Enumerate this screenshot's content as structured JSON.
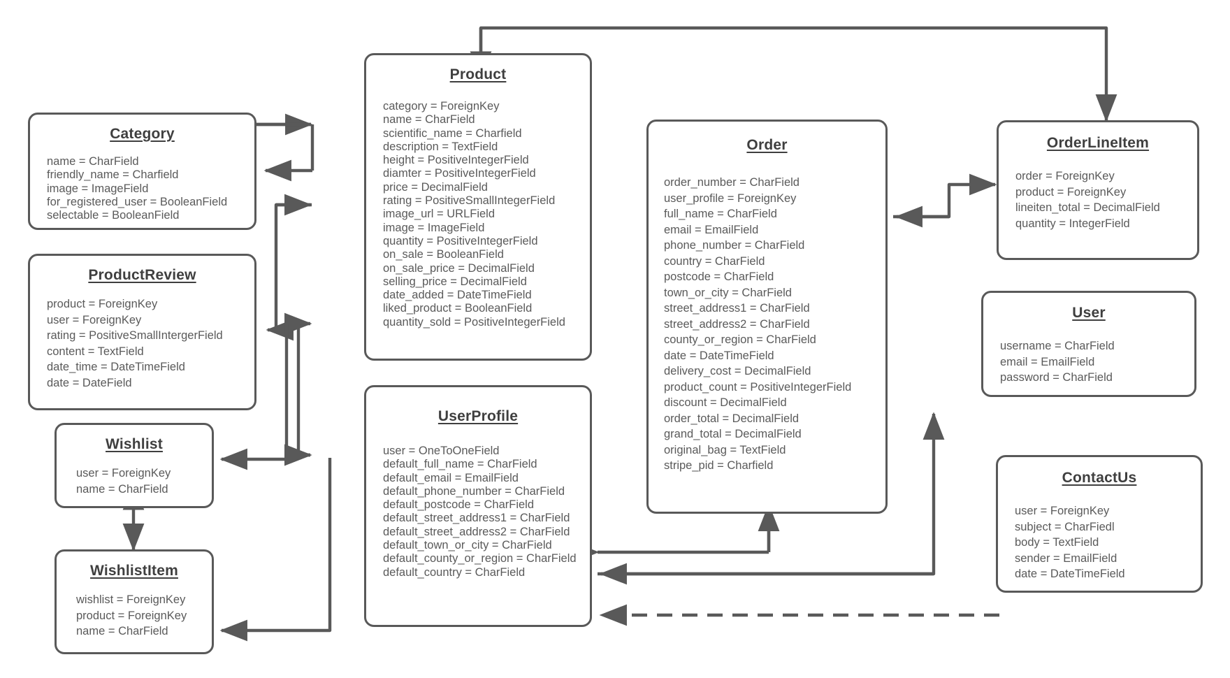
{
  "diagram": {
    "kind": "django-model-er-diagram",
    "background_color": "#ffffff",
    "box_border_color": "#595959",
    "text_color": "#5a5a5a",
    "title_color": "#3f3f3f",
    "connector_color": "#595959"
  },
  "entities": {
    "category": {
      "title": "Category",
      "fields": [
        "name = CharField",
        "friendly_name = Charfield",
        "image = ImageField",
        "for_registered_user = BooleanField",
        "selectable = BooleanField"
      ]
    },
    "product_review": {
      "title": "ProductReview",
      "fields": [
        "product = ForeignKey",
        "user = ForeignKey",
        "rating = PositiveSmallIntergerField",
        "content = TextField",
        "date_time = DateTimeField",
        "date = DateField"
      ]
    },
    "wishlist": {
      "title": "Wishlist",
      "fields": [
        "user = ForeignKey",
        "name = CharField"
      ]
    },
    "wishlist_item": {
      "title": "WishlistItem",
      "fields": [
        "wishlist = ForeignKey",
        "product = ForeignKey",
        "name = CharField"
      ]
    },
    "product": {
      "title": "Product",
      "fields": [
        "category = ForeignKey",
        "name = CharField",
        "scientific_name = Charfield",
        "description = TextField",
        "height = PositiveIntegerField",
        "diamter = PositiveIntegerField",
        "price = DecimalField",
        "rating = PositiveSmallIntegerField",
        "image_url = URLField",
        "image = ImageField",
        "quantity = PositiveIntegerField",
        "on_sale = BooleanField",
        "on_sale_price = DecimalField",
        "selling_price = DecimalField",
        "date_added = DateTimeField",
        "liked_product = BooleanField",
        "quantity_sold = PositiveIntegerField"
      ]
    },
    "user_profile": {
      "title": "UserProfile",
      "fields": [
        "user = OneToOneField",
        "default_full_name = CharField",
        "default_email = EmailField",
        "default_phone_number = CharField",
        "default_postcode = CharField",
        "default_street_address1 = CharField",
        "default_street_address2 = CharField",
        "default_town_or_city = CharField",
        "default_county_or_region = CharField",
        "default_country = CharField"
      ]
    },
    "order": {
      "title": "Order",
      "fields": [
        "order_number = CharField",
        "user_profile = ForeignKey",
        "full_name = CharField",
        "email = EmailField",
        "phone_number = CharField",
        "country = CharField",
        "postcode = CharField",
        "town_or_city = CharField",
        "street_address1 = CharField",
        "street_address2 = CharField",
        "county_or_region = CharField",
        "date = DateTimeField",
        "delivery_cost = DecimalField",
        "product_count = PositiveIntegerField",
        "discount = DecimalField",
        "order_total = DecimalField",
        "grand_total = DecimalField",
        "original_bag = TextField",
        "stripe_pid = Charfield"
      ]
    },
    "order_line_item": {
      "title": "OrderLineItem",
      "fields": [
        "order = ForeignKey",
        "product = ForeignKey",
        " lineiten_total = DecimalField",
        "quantity = IntegerField"
      ]
    },
    "user": {
      "title": "User",
      "fields": [
        "username = CharField",
        "email = EmailField",
        "password = CharField"
      ]
    },
    "contact_us": {
      "title": "ContactUs",
      "fields": [
        "user = ForeignKey",
        "subject = CharFiedl",
        "body = TextField",
        "sender = EmailField",
        "date = DateTimeField"
      ]
    }
  },
  "relationships": [
    {
      "name": "category-to-product",
      "from": "Category",
      "to": "Product",
      "style": "solid-arrow"
    },
    {
      "name": "product-to-category",
      "from": "Product",
      "to": "Category",
      "style": "solid-arrow"
    },
    {
      "name": "product-to-productreview",
      "from": "Product",
      "to": "ProductReview",
      "style": "solid-arrow"
    },
    {
      "name": "productreview-to-product",
      "from": "ProductReview",
      "to": "Product",
      "style": "solid-arrow"
    },
    {
      "name": "product-to-wishlist",
      "from": "Product",
      "to": "Wishlist",
      "style": "solid-arrow"
    },
    {
      "name": "wishlist-to-wishlistitem",
      "from": "Wishlist",
      "to": "WishlistItem",
      "style": "solid-double-arrow"
    },
    {
      "name": "product-to-wishlistitem",
      "from": "Product",
      "to": "WishlistItem",
      "style": "solid-arrow"
    },
    {
      "name": "product-to-userprofile",
      "from": "Product",
      "to": "UserProfile",
      "style": "solid-arrow"
    },
    {
      "name": "product-to-orderlineitem",
      "from": "Product",
      "to": "OrderLineItem",
      "style": "solid-arrow"
    },
    {
      "name": "order-to-orderlineitem",
      "from": "Order",
      "to": "OrderLineItem",
      "style": "solid-arrow"
    },
    {
      "name": "orderlineitem-to-order",
      "from": "OrderLineItem",
      "to": "Order",
      "style": "solid-arrow"
    },
    {
      "name": "userprofile-to-order",
      "from": "UserProfile",
      "to": "Order",
      "style": "solid-arrow"
    },
    {
      "name": "order-to-userprofile",
      "from": "Order",
      "to": "UserProfile",
      "style": "solid-arrow"
    },
    {
      "name": "userprofile-to-user",
      "from": "UserProfile",
      "to": "User",
      "style": "solid-arrow"
    },
    {
      "name": "contactus-to-userprofile",
      "from": "ContactUs",
      "to": "UserProfile",
      "style": "solid-arrow"
    },
    {
      "name": "contactus-to-userprofile-dashed",
      "from": "ContactUs",
      "to": "UserProfile",
      "style": "dashed-arrow"
    }
  ]
}
